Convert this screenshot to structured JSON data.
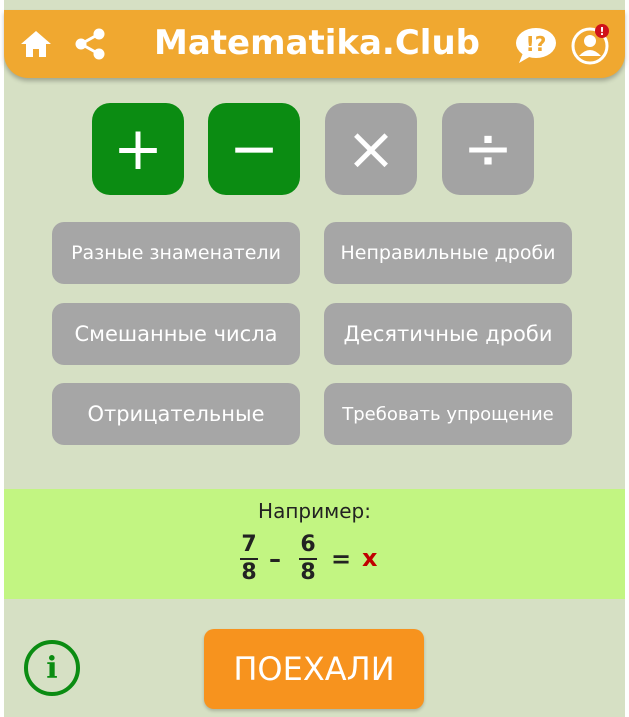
{
  "header": {
    "title": "Matematika.Club",
    "icons": [
      "home-icon",
      "share-icon",
      "help-icon",
      "profile-icon"
    ],
    "notification_badge": "!"
  },
  "operations": [
    {
      "symbol": "+",
      "name": "plus",
      "active": true
    },
    {
      "symbol": "−",
      "name": "minus",
      "active": true
    },
    {
      "symbol": "×",
      "name": "multiply",
      "active": false
    },
    {
      "symbol": "÷",
      "name": "divide",
      "active": false
    }
  ],
  "options": [
    {
      "label": "Разные знаменатели"
    },
    {
      "label": "Неправильные дроби"
    },
    {
      "label": "Смешанные числа"
    },
    {
      "label": "Десятичные дроби"
    },
    {
      "label": "Отрицательные"
    },
    {
      "label": "Требовать упрощение"
    }
  ],
  "example": {
    "title": "Например:",
    "frac1": {
      "num": "7",
      "den": "8"
    },
    "operator": "–",
    "frac2": {
      "num": "6",
      "den": "8"
    },
    "equals": "=",
    "answer": "x"
  },
  "footer": {
    "go_label": "ПОЕХАЛИ",
    "info_label": "i"
  },
  "colors": {
    "header": "#f0a830",
    "active": "#0b8c12",
    "inactive": "#a3a3a3",
    "background": "#d6e0c4",
    "example_bg": "#c2f582",
    "go_button": "#f7931e"
  }
}
